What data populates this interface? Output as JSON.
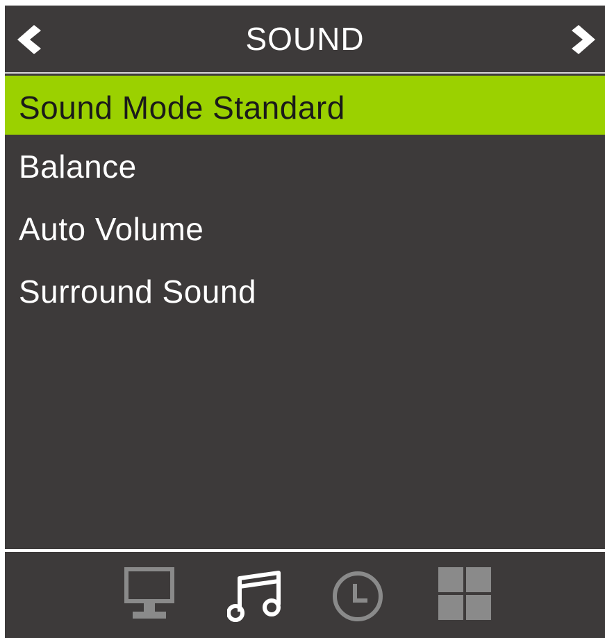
{
  "header": {
    "title": "SOUND",
    "prev_icon": "chevron-left-icon",
    "next_icon": "chevron-right-icon"
  },
  "menu": {
    "items": [
      {
        "label": "Sound Mode Standard",
        "selected": true
      },
      {
        "label": "Balance",
        "selected": false
      },
      {
        "label": "Auto Volume",
        "selected": false
      },
      {
        "label": "Surround Sound",
        "selected": false
      }
    ]
  },
  "footer": {
    "tabs": [
      {
        "icon": "monitor-icon",
        "active": false
      },
      {
        "icon": "music-note-icon",
        "active": true
      },
      {
        "icon": "clock-icon",
        "active": false
      },
      {
        "icon": "grid-icon",
        "active": false
      }
    ]
  },
  "colors": {
    "background": "#3d3a3a",
    "highlight": "#9bd100",
    "text": "#ffffff",
    "inactive_icon": "#8a8a8a"
  }
}
